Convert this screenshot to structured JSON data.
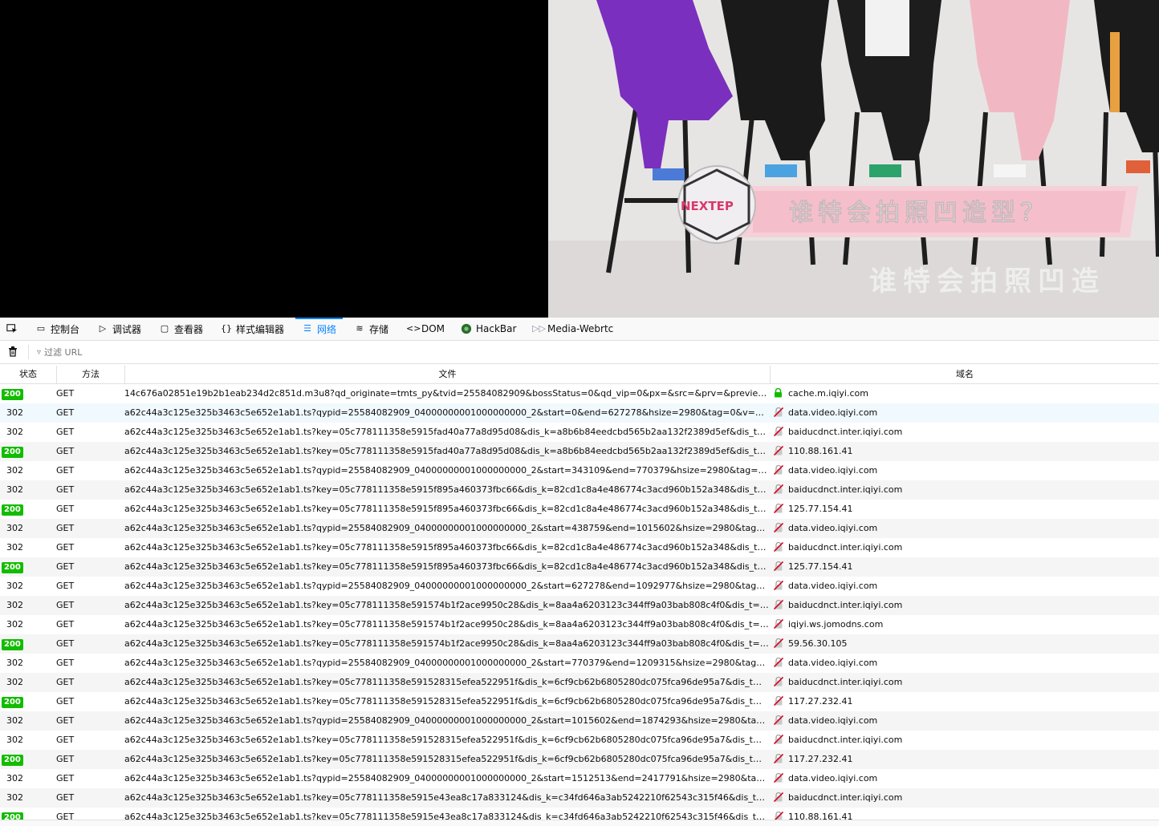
{
  "video": {
    "banner_text": "谁特会拍照凹造型？",
    "subtitle_text": "谁特会拍照凹造",
    "logo_text": "NEXTEP"
  },
  "toolbox": {
    "tabs": [
      {
        "label": "控制台",
        "icon": "console-icon"
      },
      {
        "label": "调试器",
        "icon": "debugger-icon"
      },
      {
        "label": "查看器",
        "icon": "inspector-icon"
      },
      {
        "label": "样式编辑器",
        "icon": "style-editor-icon"
      },
      {
        "label": "网络",
        "icon": "network-icon",
        "active": true
      },
      {
        "label": "存储",
        "icon": "storage-icon"
      },
      {
        "label": "DOM",
        "icon": "dom-icon"
      },
      {
        "label": "HackBar",
        "icon": "hackbar-icon"
      },
      {
        "label": "Media-Webrtc",
        "icon": "media-webrtc-icon"
      }
    ]
  },
  "filter": {
    "placeholder": "过滤 URL"
  },
  "columns": {
    "status": "状态",
    "method": "方法",
    "file": "文件",
    "domain": "域名"
  },
  "colors": {
    "ok_badge": "#12bc00",
    "active_tab": "#0a84ff",
    "secure": "#12bc00",
    "insecure": "#d70022"
  },
  "requests": [
    {
      "status": "200",
      "method": "GET",
      "file": "14c676a02851e19b2b1eab234d2c851d.m3u8?qd_originate=tmts_py&tvid=25584082909&bossStatus=0&qd_vip=0&px=&src=&prv=&previewType=&pr...",
      "domain": "cache.m.iqiyi.com",
      "secure": true
    },
    {
      "status": "302",
      "method": "GET",
      "file": "a62c44a3c125e325b3463c5e652e1ab1.ts?qypid=25584082909_04000000001000000000_2&start=0&end=627278&hsize=2980&tag=0&v=&contentl...",
      "domain": "data.video.iqiyi.com",
      "secure": false
    },
    {
      "status": "302",
      "method": "GET",
      "file": "a62c44a3c125e325b3463c5e652e1ab1.ts?key=05c778111358e5915fad40a77a8d95d08&dis_k=a8b6b84eedcbd565b2aa132f2389d5ef&dis_t=154209...",
      "domain": "baiducdnct.inter.iqiyi.com",
      "secure": false
    },
    {
      "status": "200",
      "method": "GET",
      "file": "a62c44a3c125e325b3463c5e652e1ab1.ts?key=05c778111358e5915fad40a77a8d95d08&dis_k=a8b6b84eedcbd565b2aa132f2389d5ef&dis_t=154209...",
      "domain": "110.88.161.41",
      "secure": false
    },
    {
      "status": "302",
      "method": "GET",
      "file": "a62c44a3c125e325b3463c5e652e1ab1.ts?qypid=25584082909_04000000001000000000_2&start=343109&end=770379&hsize=2980&tag=1&v=&c...",
      "domain": "data.video.iqiyi.com",
      "secure": false
    },
    {
      "status": "302",
      "method": "GET",
      "file": "a62c44a3c125e325b3463c5e652e1ab1.ts?key=05c778111358e5915f895a460373fbc66&dis_k=82cd1c8a4e486774c3acd960b152a348&dis_t=15420...",
      "domain": "baiducdnct.inter.iqiyi.com",
      "secure": false
    },
    {
      "status": "200",
      "method": "GET",
      "file": "a62c44a3c125e325b3463c5e652e1ab1.ts?key=05c778111358e5915f895a460373fbc66&dis_k=82cd1c8a4e486774c3acd960b152a348&dis_t=15420...",
      "domain": "125.77.154.41",
      "secure": false
    },
    {
      "status": "302",
      "method": "GET",
      "file": "a62c44a3c125e325b3463c5e652e1ab1.ts?qypid=25584082909_04000000001000000000_2&start=438759&end=1015602&hsize=2980&tag=1&v=&c...",
      "domain": "data.video.iqiyi.com",
      "secure": false
    },
    {
      "status": "302",
      "method": "GET",
      "file": "a62c44a3c125e325b3463c5e652e1ab1.ts?key=05c778111358e5915f895a460373fbc66&dis_k=82cd1c8a4e486774c3acd960b152a348&dis_t=15420...",
      "domain": "baiducdnct.inter.iqiyi.com",
      "secure": false
    },
    {
      "status": "200",
      "method": "GET",
      "file": "a62c44a3c125e325b3463c5e652e1ab1.ts?key=05c778111358e5915f895a460373fbc66&dis_k=82cd1c8a4e486774c3acd960b152a348&dis_t=15420...",
      "domain": "125.77.154.41",
      "secure": false
    },
    {
      "status": "302",
      "method": "GET",
      "file": "a62c44a3c125e325b3463c5e652e1ab1.ts?qypid=25584082909_04000000001000000000_2&start=627278&end=1092977&hsize=2980&tag=1&v=&c...",
      "domain": "data.video.iqiyi.com",
      "secure": false
    },
    {
      "status": "302",
      "method": "GET",
      "file": "a62c44a3c125e325b3463c5e652e1ab1.ts?key=05c778111358e591574b1f2ace9950c28&dis_k=8aa4a6203123c344ff9a03bab808c4f0&dis_t=154209...",
      "domain": "baiducdnct.inter.iqiyi.com",
      "secure": false
    },
    {
      "status": "302",
      "method": "GET",
      "file": "a62c44a3c125e325b3463c5e652e1ab1.ts?key=05c778111358e591574b1f2ace9950c28&dis_k=8aa4a6203123c344ff9a03bab808c4f0&dis_t=154209...",
      "domain": "iqiyi.ws.jomodns.com",
      "secure": false
    },
    {
      "status": "200",
      "method": "GET",
      "file": "a62c44a3c125e325b3463c5e652e1ab1.ts?key=05c778111358e591574b1f2ace9950c28&dis_k=8aa4a6203123c344ff9a03bab808c4f0&dis_t=154209...",
      "domain": "59.56.30.105",
      "secure": false
    },
    {
      "status": "302",
      "method": "GET",
      "file": "a62c44a3c125e325b3463c5e652e1ab1.ts?qypid=25584082909_04000000001000000000_2&start=770379&end=1209315&hsize=2980&tag=1&v=&c...",
      "domain": "data.video.iqiyi.com",
      "secure": false
    },
    {
      "status": "302",
      "method": "GET",
      "file": "a62c44a3c125e325b3463c5e652e1ab1.ts?key=05c778111358e591528315efea522951f&dis_k=6cf9cb62b6805280dc075fca96de95a7&dis_t=1542090...",
      "domain": "baiducdnct.inter.iqiyi.com",
      "secure": false
    },
    {
      "status": "200",
      "method": "GET",
      "file": "a62c44a3c125e325b3463c5e652e1ab1.ts?key=05c778111358e591528315efea522951f&dis_k=6cf9cb62b6805280dc075fca96de95a7&dis_t=1542090...",
      "domain": "117.27.232.41",
      "secure": false
    },
    {
      "status": "302",
      "method": "GET",
      "file": "a62c44a3c125e325b3463c5e652e1ab1.ts?qypid=25584082909_04000000001000000000_2&start=1015602&end=1874293&hsize=2980&tag=1&v=&...",
      "domain": "data.video.iqiyi.com",
      "secure": false
    },
    {
      "status": "302",
      "method": "GET",
      "file": "a62c44a3c125e325b3463c5e652e1ab1.ts?key=05c778111358e591528315efea522951f&dis_k=6cf9cb62b6805280dc075fca96de95a7&dis_t=1542090...",
      "domain": "baiducdnct.inter.iqiyi.com",
      "secure": false
    },
    {
      "status": "200",
      "method": "GET",
      "file": "a62c44a3c125e325b3463c5e652e1ab1.ts?key=05c778111358e591528315efea522951f&dis_k=6cf9cb62b6805280dc075fca96de95a7&dis_t=1542090...",
      "domain": "117.27.232.41",
      "secure": false
    },
    {
      "status": "302",
      "method": "GET",
      "file": "a62c44a3c125e325b3463c5e652e1ab1.ts?qypid=25584082909_04000000001000000000_2&start=1512513&end=2417791&hsize=2980&tag=1&v=&c...",
      "domain": "data.video.iqiyi.com",
      "secure": false
    },
    {
      "status": "302",
      "method": "GET",
      "file": "a62c44a3c125e325b3463c5e652e1ab1.ts?key=05c778111358e5915e43ea8c17a833124&dis_k=c34fd646a3ab5242210f62543c315f46&dis_t=154209...",
      "domain": "baiducdnct.inter.iqiyi.com",
      "secure": false
    },
    {
      "status": "200",
      "method": "GET",
      "file": "a62c44a3c125e325b3463c5e652e1ab1.ts?key=05c778111358e5915e43ea8c17a833124&dis_k=c34fd646a3ab5242210f62543c315f46&dis_t=154209...",
      "domain": "110.88.161.41",
      "secure": false
    }
  ]
}
